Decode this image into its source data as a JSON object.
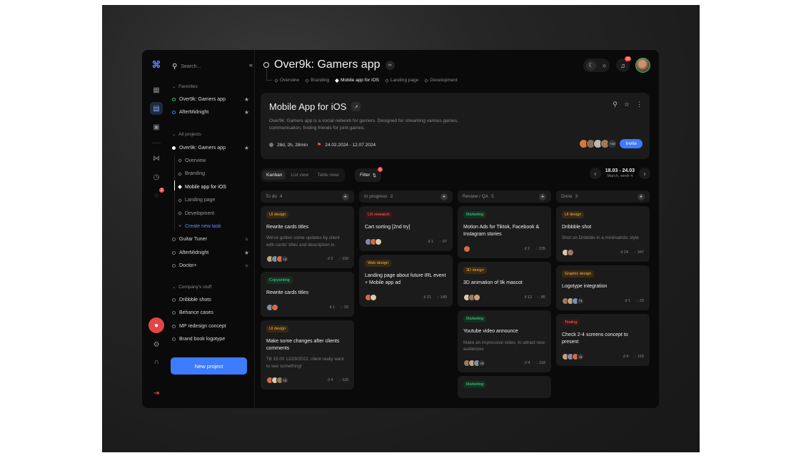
{
  "sidebar": {
    "search_placeholder": "Search...",
    "favorites_label": "Favorites",
    "favorites": [
      {
        "label": "Over9k: Gamers app",
        "starred": true,
        "dot": "#2fbf6a"
      },
      {
        "label": "AfterMidnight",
        "starred": true,
        "dot": "#3d7bff"
      }
    ],
    "all_projects_label": "All projects",
    "projects": [
      {
        "label": "Over9k: Gamers app",
        "starred": true,
        "dot": "#ffffff"
      },
      {
        "label": "Guitar Tuner",
        "starred": false,
        "dot": "#777777"
      },
      {
        "label": "AfterMidnight",
        "starred": true,
        "dot": "#777777"
      },
      {
        "label": "Doctor+",
        "starred": false,
        "dot": "#777777"
      }
    ],
    "subitems": [
      "Overview",
      "Branding",
      "Mobile app for iOS",
      "Landing page",
      "Development"
    ],
    "create_task_label": "Create new task",
    "company_label": "Company's stuff",
    "company_items": [
      "Dribbble shots",
      "Behance cases",
      "MP redesign concept",
      "Brand book logotype"
    ],
    "new_project_label": "New project"
  },
  "header": {
    "title": "Over9k: Gamers app",
    "tabs": [
      "Overview",
      "Branding",
      "Mobile app for iOS",
      "Landing page",
      "Development"
    ],
    "active_tab": 2,
    "notification_count": "10"
  },
  "hero": {
    "title": "Mobile App for iOS",
    "description": "Over9k: Gamers app is a social network for gamers. Designed for streaming various games, communication, finding friends for joint games.",
    "time_spent": "28d, 2h, 28min",
    "date_range": "24.02.2024 - 12.07.2024",
    "team_extra": "+10",
    "invite_label": "Invite"
  },
  "toolbar": {
    "views": [
      "Kanban",
      "List view",
      "Table view"
    ],
    "filter_label": "Filter",
    "filter_count": "3",
    "week_range": "18.03 - 24.03",
    "week_label": "March, week 4"
  },
  "colors": {
    "accent": "#3d7bff",
    "tags": {
      "UI design": {
        "bg": "#3a2a12",
        "fg": "#f2b04a"
      },
      "UX research": {
        "bg": "#3a1616",
        "fg": "#ff6b6b"
      },
      "Marketing": {
        "bg": "#133222",
        "fg": "#4bd98a"
      },
      "Web design": {
        "bg": "#3a2a12",
        "fg": "#f2b04a"
      },
      "3D design": {
        "bg": "#3a2a12",
        "fg": "#f2b04a"
      },
      "Copywriting": {
        "bg": "#133222",
        "fg": "#4bd98a"
      },
      "Graphic design": {
        "bg": "#3a2a12",
        "fg": "#f2b04a"
      },
      "Testing": {
        "bg": "#3a1616",
        "fg": "#ff6b6b"
      }
    }
  },
  "columns": [
    {
      "title": "To do",
      "count": "4",
      "cards": [
        {
          "tag": "UI design",
          "title": "Rewrite cards titles",
          "desc": "We've gotten some updates by client with cards' titles and description in.",
          "avatars": 3,
          "extra": "+3",
          "links": "2",
          "comments": "118"
        },
        {
          "tag": "Copywriting",
          "title": "Rewrite cards titles",
          "desc": "",
          "avatars": 2,
          "extra": "",
          "links": "1",
          "comments": "19"
        },
        {
          "tag": "UI design",
          "title": "Make some changes after clients comments",
          "desc": "Till 15:00 12/29/2022, client really want to see something!",
          "avatars": 3,
          "extra": "+2",
          "links": "4",
          "comments": "118"
        }
      ]
    },
    {
      "title": "In progress",
      "count": "2",
      "cards": [
        {
          "tag": "UX research",
          "title": "Cart sorting [2nd try]",
          "desc": "",
          "avatars": 3,
          "extra": "",
          "links": "1",
          "comments": "97"
        },
        {
          "tag": "Web design",
          "title": "Landing page about future IRL event + Mobile app ad",
          "desc": "",
          "avatars": 2,
          "extra": "",
          "links": "21",
          "comments": "140"
        }
      ]
    },
    {
      "title": "Review / QA",
      "count": "5",
      "cards": [
        {
          "tag": "Marketing",
          "title": "Motion Ads for Tiktok, Facebook & Instagram stories",
          "desc": "",
          "avatars": 1,
          "extra": "",
          "links": "2",
          "comments": "235"
        },
        {
          "tag": "3D design",
          "title": "3D animation of 9k mascot",
          "desc": "",
          "avatars": 3,
          "extra": "",
          "links": "12",
          "comments": "85"
        },
        {
          "tag": "Marketing",
          "title": "Youtube video announce",
          "desc": "Make an impressive video, to attract new audiences",
          "avatars": 3,
          "extra": "+2",
          "links": "4",
          "comments": "118"
        },
        {
          "tag": "Marketing",
          "title": "",
          "desc": "",
          "avatars": 0,
          "extra": "",
          "links": "",
          "comments": ""
        }
      ]
    },
    {
      "title": "Done",
      "count": "3",
      "cards": [
        {
          "tag": "UI design",
          "title": "Dribbble shot",
          "desc": "Shot on Dribbble in a minimalistic style",
          "avatars": 2,
          "extra": "",
          "links": "24",
          "comments": "347"
        },
        {
          "tag": "Graphic design",
          "title": "Logotype integration",
          "desc": "",
          "avatars": 3,
          "extra": "+1",
          "links": "1",
          "comments": "23"
        },
        {
          "tag": "Testing",
          "title": "Check 2-4 screens concept to present",
          "desc": "",
          "avatars": 3,
          "extra": "+2",
          "links": "4",
          "comments": "118"
        }
      ]
    }
  ]
}
